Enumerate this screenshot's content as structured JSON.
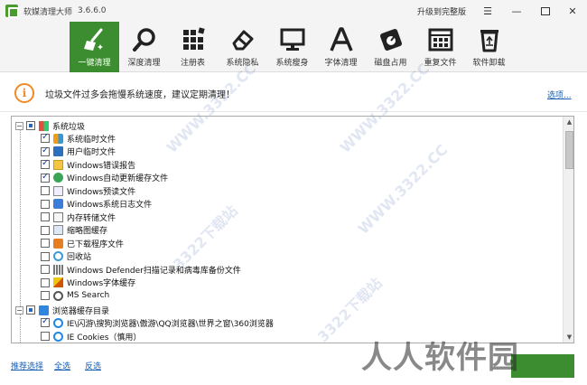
{
  "window": {
    "title": "软媒清理大师",
    "version": "3.6.6.0",
    "upgrade_label": "升级到完整版",
    "menu_glyph": "☰",
    "minimize_glyph": "—",
    "close_glyph": "✕"
  },
  "toolbar": {
    "items": [
      {
        "label": "一键清理",
        "icon": "broom-icon"
      },
      {
        "label": "深度清理",
        "icon": "magnifier-icon"
      },
      {
        "label": "注册表",
        "icon": "registry-blocks-icon"
      },
      {
        "label": "系统隐私",
        "icon": "eraser-icon"
      },
      {
        "label": "系统瘦身",
        "icon": "monitor-icon"
      },
      {
        "label": "字体清理",
        "icon": "font-a-icon"
      },
      {
        "label": "磁盘占用",
        "icon": "disk-gauge-icon"
      },
      {
        "label": "重复文件",
        "icon": "duplicate-grid-icon"
      },
      {
        "label": "软件卸载",
        "icon": "recycle-icon"
      }
    ],
    "active_color": "#3c8d2f"
  },
  "notice": {
    "icon_glyph": "i",
    "text": "垃圾文件过多会拖慢系统速度，建议定期清理！",
    "options_label": "选项..."
  },
  "tree": {
    "groups": [
      {
        "label": "系统垃圾",
        "expander": "−",
        "items": [
          {
            "label": "系统临时文件",
            "checked": true,
            "icon": "windows-flag-icon"
          },
          {
            "label": "用户临时文件",
            "checked": true,
            "icon": "user-files-icon"
          },
          {
            "label": "Windows错误报告",
            "checked": true,
            "icon": "warning-report-icon"
          },
          {
            "label": "Windows自动更新缓存文件",
            "checked": true,
            "icon": "update-shield-icon"
          },
          {
            "label": "Windows预读文件",
            "checked": false,
            "icon": "prefetch-icon"
          },
          {
            "label": "Windows系统日志文件",
            "checked": false,
            "icon": "log-file-icon"
          },
          {
            "label": "内存转储文件",
            "checked": false,
            "icon": "memory-dump-icon"
          },
          {
            "label": "缩略图缓存",
            "checked": false,
            "icon": "thumbnail-icon"
          },
          {
            "label": "已下载程序文件",
            "checked": false,
            "icon": "download-icon"
          },
          {
            "label": "回收站",
            "checked": false,
            "icon": "recycle-bin-icon"
          },
          {
            "label": "Windows Defender扫描记录和病毒库备份文件",
            "checked": false,
            "icon": "defender-bars-icon"
          },
          {
            "label": "Windows字体缓存",
            "checked": false,
            "icon": "font-cache-icon"
          },
          {
            "label": "MS Search",
            "checked": false,
            "icon": "search-icon"
          }
        ]
      },
      {
        "label": "浏览器缓存目录",
        "expander": "−",
        "items": [
          {
            "label": "IE\\闪游\\搜狗浏览器\\傲游\\QQ浏览器\\世界之窗\\360浏览器",
            "checked": true,
            "icon": "ie-icon"
          },
          {
            "label": "IE Cookies（慎用）",
            "checked": false,
            "icon": "ie-icon"
          }
        ]
      }
    ]
  },
  "bottom": {
    "recommend_label": "推荐选择",
    "select_all_label": "全选",
    "invert_label": "反选"
  },
  "watermarks": {
    "diagonal": "3322下载站",
    "diagonal_url": "WWW.3322.CC",
    "big": "人人软件园"
  }
}
